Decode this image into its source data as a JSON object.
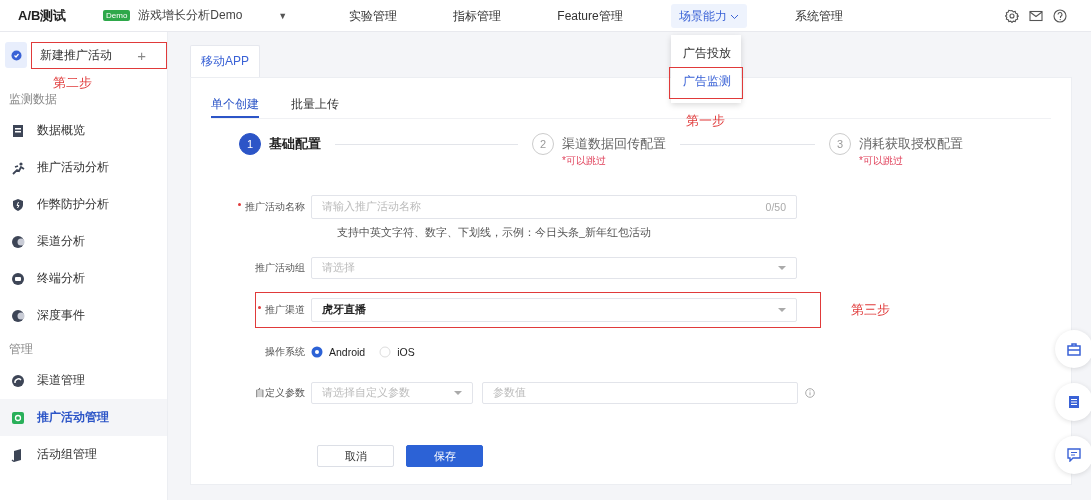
{
  "header": {
    "logo": "A/B测试",
    "project_badge": "Demo",
    "project": "游戏增长分析Demo",
    "caret": "▼",
    "nav": [
      {
        "label": "实验管理",
        "selected": false,
        "expanded": false
      },
      {
        "label": "指标管理",
        "selected": false,
        "expanded": false
      },
      {
        "label": "Feature管理",
        "selected": false,
        "expanded": false
      },
      {
        "label": "场景能力",
        "selected": true,
        "expanded": true
      },
      {
        "label": "系统管理",
        "selected": false,
        "expanded": false
      }
    ]
  },
  "nav_menu": {
    "items": [
      {
        "label": "广告投放",
        "selected": false
      },
      {
        "label": "广告监测",
        "selected": true,
        "annotation": "第一步"
      }
    ]
  },
  "sidebar": {
    "new_button": "新建推广活动",
    "plus": "+",
    "annotation": "第二步",
    "sections": [
      {
        "title": "监测数据",
        "items": [
          {
            "label": "数据概览",
            "selected": false
          },
          {
            "label": "推广活动分析",
            "selected": false
          },
          {
            "label": "作弊防护分析",
            "selected": false
          },
          {
            "label": "渠道分析",
            "selected": false
          },
          {
            "label": "终端分析",
            "selected": false
          },
          {
            "label": "深度事件",
            "selected": false
          }
        ]
      },
      {
        "title": "管理",
        "items": [
          {
            "label": "渠道管理",
            "selected": false
          },
          {
            "label": "推广活动管理",
            "selected": true
          },
          {
            "label": "活动组管理",
            "selected": false
          }
        ]
      }
    ]
  },
  "platform_tabs": [
    {
      "label": "移动APP",
      "selected": true
    }
  ],
  "mode_tabs": [
    {
      "label": "单个创建",
      "selected": true
    },
    {
      "label": "批量上传",
      "selected": false
    }
  ],
  "steps": [
    {
      "number": "1",
      "title": "基础配置",
      "selected": true
    },
    {
      "number": "2",
      "title": "渠道数据回传配置",
      "note": "*可以跳过",
      "selected": false
    },
    {
      "number": "3",
      "title": "消耗获取授权配置",
      "note": "*可以跳过",
      "selected": false
    }
  ],
  "form": {
    "fields": [
      {
        "kind": "text",
        "label": "推广活动名称",
        "required": true,
        "placeholder": "请输入推广活动名称",
        "counter": "0/50",
        "help": "支持中英文字符、数字、下划线，示例：今日头条_新年红包活动"
      },
      {
        "kind": "select",
        "label": "推广活动组",
        "required": false,
        "placeholder": "请选择"
      },
      {
        "kind": "select",
        "label": "推广渠道",
        "required": true,
        "value": "虎牙直播",
        "annotation": "第三步"
      },
      {
        "kind": "radio",
        "label": "操作系统",
        "required": false,
        "options": [
          {
            "label": "Android",
            "selected": true
          },
          {
            "label": "iOS",
            "selected": false
          }
        ]
      },
      {
        "kind": "pair",
        "label": "自定义参数",
        "required": false,
        "placeholder": "请选择自定义参数",
        "value_placeholder": "参数值"
      }
    ],
    "buttons": [
      {
        "label": "取消",
        "kind": "secondary"
      },
      {
        "label": "保存",
        "kind": "primary"
      }
    ]
  }
}
